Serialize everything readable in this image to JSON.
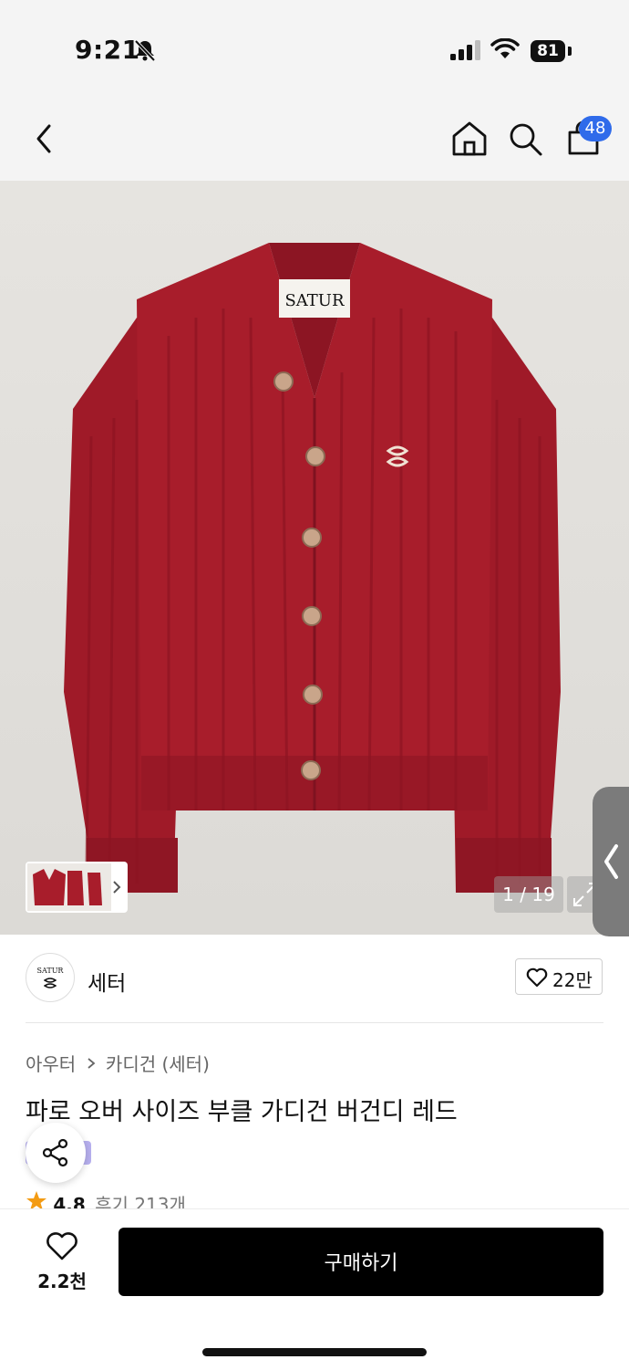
{
  "status_bar": {
    "time": "9:21",
    "battery": "81"
  },
  "nav": {
    "cart_count": "48"
  },
  "gallery": {
    "counter": "1 / 19",
    "brand_label": "SATUR"
  },
  "brand": {
    "logo_text": "SATUR",
    "name": "세터",
    "likes": "22만"
  },
  "product": {
    "breadcrumb": [
      "아우터",
      "카디건 (세터)"
    ],
    "title": "파로 오버 사이즈 부클 가디건 버건디 레드",
    "rating": "4.8",
    "reviews": "후기 213개"
  },
  "bottom": {
    "wish_count": "2.2천",
    "buy_label": "구매하기"
  },
  "colors": {
    "sweater": "#a81d2b",
    "badge": "#2f6bea",
    "buy_button": "#000000"
  }
}
